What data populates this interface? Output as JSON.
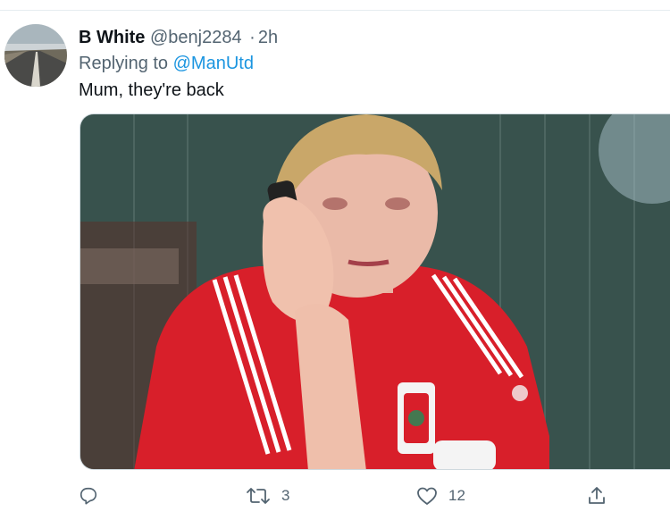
{
  "tweet": {
    "display_name": "B White",
    "handle": "@benj2284",
    "separator": "·",
    "time": "2h",
    "replying_prefix": "Replying to",
    "replying_to": "@ManUtd",
    "text": "Mum, they're back"
  },
  "actions": {
    "reply": {
      "icon": "reply-icon",
      "count": ""
    },
    "retweet": {
      "icon": "retweet-icon",
      "count": "3"
    },
    "like": {
      "icon": "heart-icon",
      "count": "12"
    },
    "share": {
      "icon": "share-icon",
      "count": ""
    }
  },
  "media": {
    "description_icon": "photo",
    "colors": {
      "shirt": "#d81f2a",
      "backdrop": "#3f5a55"
    }
  },
  "colors": {
    "link": "#1b95e0",
    "muted": "#536471",
    "text": "#0f1419",
    "divider": "#e6ecf0"
  }
}
